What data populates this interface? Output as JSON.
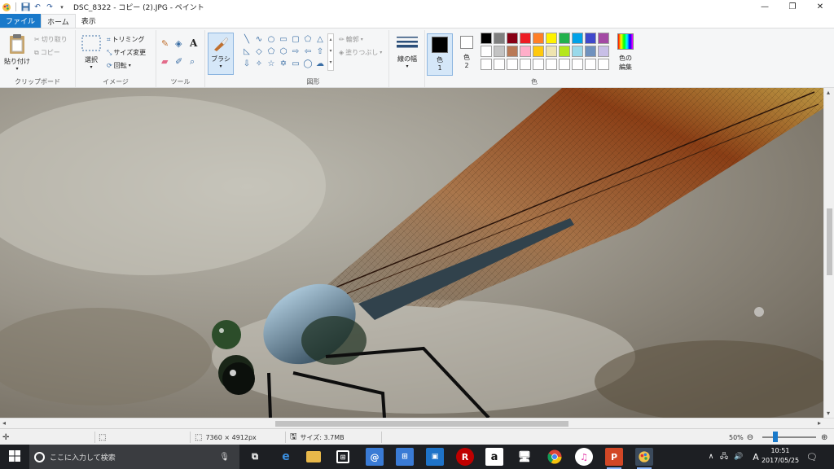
{
  "titlebar": {
    "title": "DSC_8322 - コピー (2).JPG - ペイント",
    "minimize_glyph": "—",
    "maximize_glyph": "❐",
    "close_glyph": "✕"
  },
  "tabs": [
    "ファイル",
    "ホーム",
    "表示"
  ],
  "ribbon": {
    "clipboard": {
      "paste": "貼り付け",
      "cut": "切り取り",
      "copy": "コピー",
      "group": "クリップボード"
    },
    "image": {
      "select": "選択",
      "crop": "トリミング",
      "resize": "サイズ変更",
      "rotate": "回転",
      "group": "イメージ"
    },
    "tools": {
      "group": "ツール"
    },
    "brushes": {
      "label": "ブラシ"
    },
    "shapes": {
      "outline": "輪郭",
      "fill": "塗りつぶし",
      "group": "図形"
    },
    "size": {
      "label": "線の幅"
    },
    "colors": {
      "color1_line1": "色",
      "color1_line2": "1",
      "color2_line1": "色",
      "color2_line2": "2",
      "edit_line1": "色の",
      "edit_line2": "編集",
      "group": "色",
      "color1_value": "#000000",
      "color2_value": "#ffffff"
    }
  },
  "palette": [
    "#000000",
    "#7f7f7f",
    "#880015",
    "#ed1c24",
    "#ff7f27",
    "#fff200",
    "#22b14c",
    "#00a2e8",
    "#3f48cc",
    "#a349a4",
    "#ffffff",
    "#c3c3c3",
    "#b97a57",
    "#ffaec9",
    "#ffc90e",
    "#efe4b0",
    "#b5e61d",
    "#99d9ea",
    "#7092be",
    "#c8bfe7",
    "#ffffff",
    "#ffffff",
    "#ffffff",
    "#ffffff",
    "#ffffff",
    "#ffffff",
    "#ffffff",
    "#ffffff",
    "#ffffff",
    "#ffffff"
  ],
  "status": {
    "dimensions": "7360 × 4912px",
    "size": "サイズ: 3.7MB",
    "zoom": "50%"
  },
  "taskbar": {
    "search_placeholder": "ここに入力して検索",
    "time": "10:51",
    "date": "2017/05/25",
    "ime": "A",
    "tray_up": "∧"
  }
}
